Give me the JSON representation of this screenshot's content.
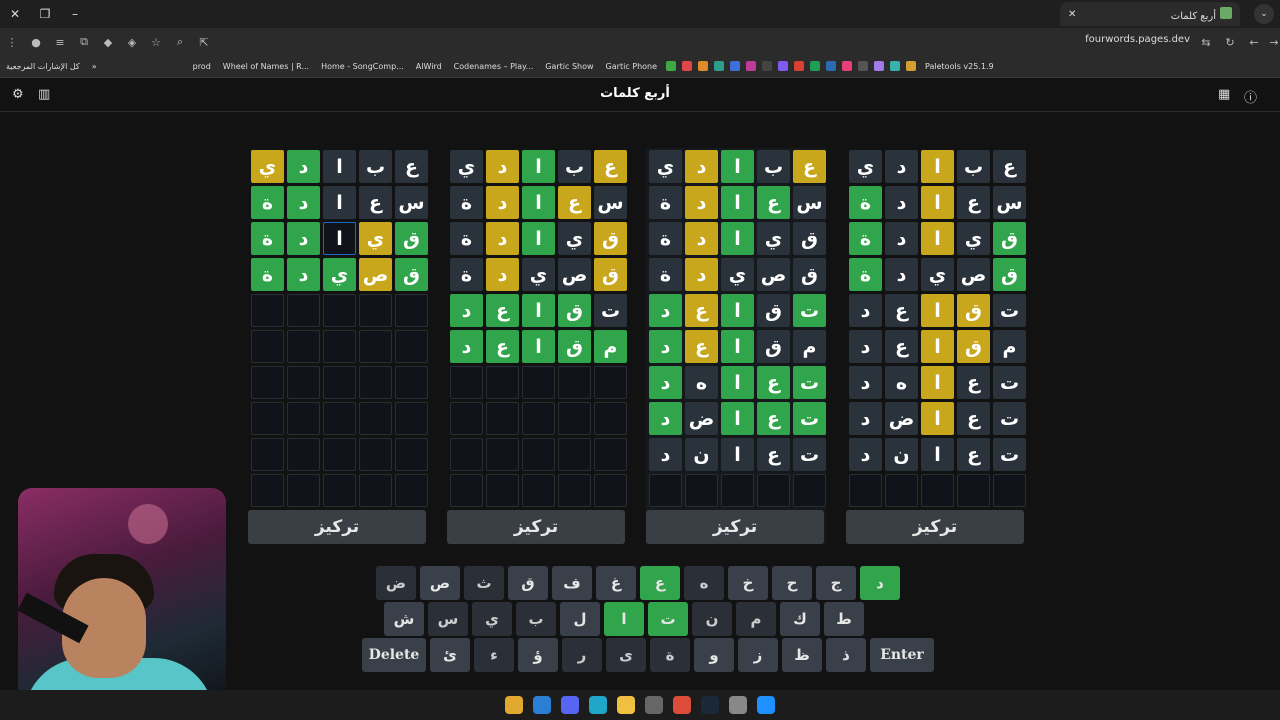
{
  "browser": {
    "tab_title": "أربع كلمات",
    "url": "fourwords.pages.dev",
    "bookmarks_all": "كل الإشارات المرجعية",
    "bookmarks": [
      "prod",
      "Wheel of Names | R...",
      "Home - SongComp...",
      "AlWird",
      "Codenames – Play...",
      "Gartic Show",
      "Gartic Phone",
      "Paletools v25.1.9"
    ]
  },
  "app": {
    "title": "أربع كلمات",
    "focus_label": "تركيز"
  },
  "colors": {
    "correct": "#31a54c",
    "present": "#c9a71c",
    "absent": "#2a323c",
    "background": "#121213"
  },
  "boards": [
    {
      "focused": false,
      "rows": [
        [
          [
            "ع",
            "n"
          ],
          [
            "ب",
            "n"
          ],
          [
            "ا",
            "y"
          ],
          [
            "د",
            "n"
          ],
          [
            "ي",
            "n"
          ]
        ],
        [
          [
            "س",
            "n"
          ],
          [
            "ع",
            "n"
          ],
          [
            "ا",
            "y"
          ],
          [
            "د",
            "n"
          ],
          [
            "ة",
            "g"
          ]
        ],
        [
          [
            "ق",
            "g"
          ],
          [
            "ي",
            "n"
          ],
          [
            "ا",
            "y"
          ],
          [
            "د",
            "n"
          ],
          [
            "ة",
            "g"
          ]
        ],
        [
          [
            "ق",
            "g"
          ],
          [
            "ص",
            "n"
          ],
          [
            "ي",
            "n"
          ],
          [
            "د",
            "n"
          ],
          [
            "ة",
            "g"
          ]
        ],
        [
          [
            "ت",
            "n"
          ],
          [
            "ق",
            "y"
          ],
          [
            "ا",
            "y"
          ],
          [
            "ع",
            "n"
          ],
          [
            "د",
            "n"
          ]
        ],
        [
          [
            "م",
            "n"
          ],
          [
            "ق",
            "y"
          ],
          [
            "ا",
            "y"
          ],
          [
            "ع",
            "n"
          ],
          [
            "د",
            "n"
          ]
        ],
        [
          [
            "ت",
            "n"
          ],
          [
            "ع",
            "n"
          ],
          [
            "ا",
            "y"
          ],
          [
            "ه",
            "n"
          ],
          [
            "د",
            "n"
          ]
        ],
        [
          [
            "ت",
            "n"
          ],
          [
            "ع",
            "n"
          ],
          [
            "ا",
            "y"
          ],
          [
            "ض",
            "n"
          ],
          [
            "د",
            "n"
          ]
        ],
        [
          [
            "ت",
            "n"
          ],
          [
            "ع",
            "n"
          ],
          [
            "ا",
            "n"
          ],
          [
            "ن",
            "n"
          ],
          [
            "د",
            "n"
          ]
        ],
        [
          [
            "",
            ""
          ],
          [
            "",
            ""
          ],
          [
            "",
            ""
          ],
          [
            "",
            ""
          ],
          [
            "",
            ""
          ]
        ]
      ]
    },
    {
      "focused": true,
      "rows": [
        [
          [
            "ع",
            "y"
          ],
          [
            "ب",
            "n"
          ],
          [
            "ا",
            "g"
          ],
          [
            "د",
            "y"
          ],
          [
            "ي",
            "n"
          ]
        ],
        [
          [
            "س",
            "n"
          ],
          [
            "ع",
            "g"
          ],
          [
            "ا",
            "g"
          ],
          [
            "د",
            "y"
          ],
          [
            "ة",
            "n"
          ]
        ],
        [
          [
            "ق",
            "n"
          ],
          [
            "ي",
            "n"
          ],
          [
            "ا",
            "g"
          ],
          [
            "د",
            "y"
          ],
          [
            "ة",
            "n"
          ]
        ],
        [
          [
            "ق",
            "n"
          ],
          [
            "ص",
            "n"
          ],
          [
            "ي",
            "n"
          ],
          [
            "د",
            "y"
          ],
          [
            "ة",
            "n"
          ]
        ],
        [
          [
            "ت",
            "g"
          ],
          [
            "ق",
            "n"
          ],
          [
            "ا",
            "g"
          ],
          [
            "ع",
            "y"
          ],
          [
            "د",
            "g"
          ]
        ],
        [
          [
            "م",
            "n"
          ],
          [
            "ق",
            "n"
          ],
          [
            "ا",
            "g"
          ],
          [
            "ع",
            "y"
          ],
          [
            "د",
            "g"
          ]
        ],
        [
          [
            "ت",
            "g"
          ],
          [
            "ع",
            "g"
          ],
          [
            "ا",
            "g"
          ],
          [
            "ه",
            "n"
          ],
          [
            "د",
            "g"
          ]
        ],
        [
          [
            "ت",
            "g"
          ],
          [
            "ع",
            "g"
          ],
          [
            "ا",
            "g"
          ],
          [
            "ض",
            "n"
          ],
          [
            "د",
            "g"
          ]
        ],
        [
          [
            "ت",
            "n"
          ],
          [
            "ع",
            "n"
          ],
          [
            "ا",
            "n"
          ],
          [
            "ن",
            "n"
          ],
          [
            "د",
            "n"
          ]
        ],
        [
          [
            "",
            ""
          ],
          [
            "",
            ""
          ],
          [
            "",
            ""
          ],
          [
            "",
            ""
          ],
          [
            "",
            ""
          ]
        ]
      ]
    },
    {
      "focused": false,
      "rows": [
        [
          [
            "ع",
            "y"
          ],
          [
            "ب",
            "n"
          ],
          [
            "ا",
            "g"
          ],
          [
            "د",
            "y"
          ],
          [
            "ي",
            "n"
          ]
        ],
        [
          [
            "س",
            "n"
          ],
          [
            "ع",
            "y"
          ],
          [
            "ا",
            "g"
          ],
          [
            "د",
            "y"
          ],
          [
            "ة",
            "n"
          ]
        ],
        [
          [
            "ق",
            "y"
          ],
          [
            "ي",
            "n"
          ],
          [
            "ا",
            "g"
          ],
          [
            "د",
            "y"
          ],
          [
            "ة",
            "n"
          ]
        ],
        [
          [
            "ق",
            "y"
          ],
          [
            "ص",
            "n"
          ],
          [
            "ي",
            "n"
          ],
          [
            "د",
            "y"
          ],
          [
            "ة",
            "n"
          ]
        ],
        [
          [
            "ت",
            "n"
          ],
          [
            "ق",
            "g"
          ],
          [
            "ا",
            "g"
          ],
          [
            "ع",
            "g"
          ],
          [
            "د",
            "g"
          ]
        ],
        [
          [
            "م",
            "g"
          ],
          [
            "ق",
            "g"
          ],
          [
            "ا",
            "g"
          ],
          [
            "ع",
            "g"
          ],
          [
            "د",
            "g"
          ]
        ],
        [
          [
            "",
            ""
          ],
          [
            "",
            ""
          ],
          [
            "",
            ""
          ],
          [
            "",
            ""
          ],
          [
            "",
            ""
          ]
        ],
        [
          [
            "",
            ""
          ],
          [
            "",
            ""
          ],
          [
            "",
            ""
          ],
          [
            "",
            ""
          ],
          [
            "",
            ""
          ]
        ],
        [
          [
            "",
            ""
          ],
          [
            "",
            ""
          ],
          [
            "",
            ""
          ],
          [
            "",
            ""
          ],
          [
            "",
            ""
          ]
        ],
        [
          [
            "",
            ""
          ],
          [
            "",
            ""
          ],
          [
            "",
            ""
          ],
          [
            "",
            ""
          ],
          [
            "",
            ""
          ]
        ]
      ]
    },
    {
      "focused": false,
      "rows": [
        [
          [
            "ع",
            "n"
          ],
          [
            "ب",
            "n"
          ],
          [
            "ا",
            "n"
          ],
          [
            "د",
            "g"
          ],
          [
            "ي",
            "y"
          ]
        ],
        [
          [
            "س",
            "n"
          ],
          [
            "ع",
            "n"
          ],
          [
            "ا",
            "n"
          ],
          [
            "د",
            "g"
          ],
          [
            "ة",
            "g"
          ]
        ],
        [
          [
            "ق",
            "g"
          ],
          [
            "ي",
            "y"
          ],
          [
            "ا",
            "sel"
          ],
          [
            "د",
            "g"
          ],
          [
            "ة",
            "g"
          ]
        ],
        [
          [
            "ق",
            "g"
          ],
          [
            "ص",
            "y"
          ],
          [
            "ي",
            "g"
          ],
          [
            "د",
            "g"
          ],
          [
            "ة",
            "g"
          ]
        ],
        [
          [
            "",
            ""
          ],
          [
            "",
            ""
          ],
          [
            "",
            ""
          ],
          [
            "",
            ""
          ],
          [
            "",
            ""
          ]
        ],
        [
          [
            "",
            ""
          ],
          [
            "",
            ""
          ],
          [
            "",
            ""
          ],
          [
            "",
            ""
          ],
          [
            "",
            ""
          ]
        ],
        [
          [
            "",
            ""
          ],
          [
            "",
            ""
          ],
          [
            "",
            ""
          ],
          [
            "",
            ""
          ],
          [
            "",
            ""
          ]
        ],
        [
          [
            "",
            ""
          ],
          [
            "",
            ""
          ],
          [
            "",
            ""
          ],
          [
            "",
            ""
          ],
          [
            "",
            ""
          ]
        ],
        [
          [
            "",
            ""
          ],
          [
            "",
            ""
          ],
          [
            "",
            ""
          ],
          [
            "",
            ""
          ],
          [
            "",
            ""
          ]
        ],
        [
          [
            "",
            ""
          ],
          [
            "",
            ""
          ],
          [
            "",
            ""
          ],
          [
            "",
            ""
          ],
          [
            "",
            ""
          ]
        ]
      ]
    }
  ],
  "keyboard": {
    "row1": [
      [
        "د",
        "g"
      ],
      [
        "ج",
        ""
      ],
      [
        "ح",
        ""
      ],
      [
        "خ",
        ""
      ],
      [
        "ه",
        "dim"
      ],
      [
        "ع",
        "g"
      ],
      [
        "غ",
        ""
      ],
      [
        "ف",
        ""
      ],
      [
        "ق",
        ""
      ],
      [
        "ث",
        "dim"
      ],
      [
        "ص",
        ""
      ],
      [
        "ض",
        "dim"
      ]
    ],
    "row2": [
      [
        "ط",
        ""
      ],
      [
        "ك",
        ""
      ],
      [
        "م",
        "dim"
      ],
      [
        "ن",
        "dim"
      ],
      [
        "ت",
        "g"
      ],
      [
        "ا",
        "g"
      ],
      [
        "ل",
        ""
      ],
      [
        "ب",
        "dim"
      ],
      [
        "ي",
        "dim"
      ],
      [
        "س",
        "dim"
      ],
      [
        "ش",
        ""
      ]
    ],
    "row3": [
      [
        "Enter",
        ""
      ],
      [
        "ذ",
        ""
      ],
      [
        "ظ",
        ""
      ],
      [
        "ز",
        ""
      ],
      [
        "و",
        ""
      ],
      [
        "ة",
        "dim"
      ],
      [
        "ى",
        "dim"
      ],
      [
        "ر",
        "dim"
      ],
      [
        "ؤ",
        ""
      ],
      [
        "ء",
        "dim"
      ],
      [
        "ئ",
        ""
      ],
      [
        "Delete",
        ""
      ]
    ]
  }
}
